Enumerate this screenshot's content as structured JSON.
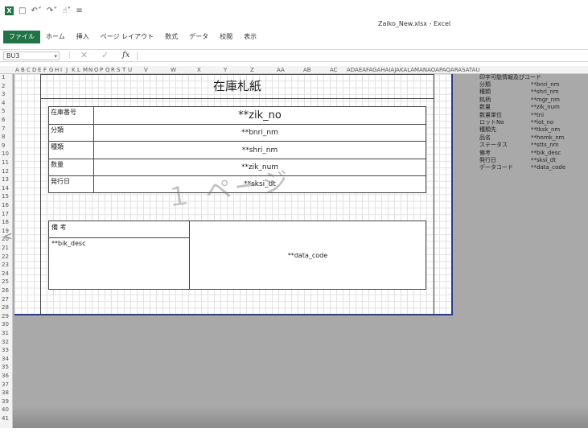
{
  "window": {
    "title": "Zaiko_New.xlsx - Excel",
    "logo": "X"
  },
  "ribbon": {
    "tabs": [
      "ファイル",
      "ホーム",
      "挿入",
      "ページ レイアウト",
      "数式",
      "データ",
      "校閲",
      "表示"
    ]
  },
  "formula_bar": {
    "name_box": "BU3",
    "fx": "fx"
  },
  "columns": [
    "A",
    "B",
    "C",
    "D",
    "E",
    "F",
    "G",
    "H",
    "I",
    "J",
    "K",
    "L",
    "M",
    "N",
    "O",
    "P",
    "Q",
    "R",
    "S",
    "T",
    "U",
    "V",
    "W",
    "X",
    "Y",
    "Z",
    "AA",
    "AB",
    "AC",
    "ADAEAFAGAHAIAJAKALAMANAOAPAQARASATAU"
  ],
  "rows": [
    "1",
    "2",
    "3",
    "4",
    "5",
    "6",
    "7",
    "8",
    "9",
    "10",
    "11",
    "12",
    "13",
    "14",
    "15",
    "16",
    "17",
    "18",
    "19",
    "20",
    "21",
    "22",
    "23",
    "24",
    "25",
    "26",
    "27",
    "28",
    "29",
    "30",
    "31",
    "32",
    "33",
    "34",
    "35",
    "36",
    "37",
    "38",
    "39",
    "40",
    "41"
  ],
  "sheet": {
    "title": "在庫札紙",
    "watermark": "１ ページ",
    "left_mark": "<",
    "fields": [
      {
        "label": "在庫番号",
        "value": "**zik_no"
      },
      {
        "label": "分類",
        "value": "**bnri_nm"
      },
      {
        "label": "種類",
        "value": "**shri_nm"
      },
      {
        "label": "数量",
        "value": "**zik_num"
      },
      {
        "label": "発行日",
        "value": "**sksi_dt"
      }
    ],
    "remarks_label": "備 考",
    "remarks_value": "**bik_desc",
    "data_code": "**data_code"
  },
  "legend": {
    "title": "印字可能情報及びコード",
    "items": [
      {
        "k": "分類",
        "v": "**bnri_nm"
      },
      {
        "k": "種類",
        "v": "**shri_nm"
      },
      {
        "k": "銘柄",
        "v": "**mgr_nm"
      },
      {
        "k": "数量",
        "v": "**zik_num"
      },
      {
        "k": "数量単位",
        "v": "**tni"
      },
      {
        "k": "ロットNo",
        "v": "**lot_no"
      },
      {
        "k": "種類先",
        "v": "**tksk_nm"
      },
      {
        "k": "品名",
        "v": "**hnmk_nm"
      },
      {
        "k": "ステータス",
        "v": "**stts_nm"
      },
      {
        "k": "備考",
        "v": "**bik_desc"
      },
      {
        "k": "発行日",
        "v": "**sksi_dt"
      },
      {
        "k": "データコード",
        "v": "**data_code"
      }
    ]
  },
  "colors": {
    "excel_green": "#217346",
    "page_border": "#2b3a8c",
    "gray_area": "#a9a9a9"
  }
}
